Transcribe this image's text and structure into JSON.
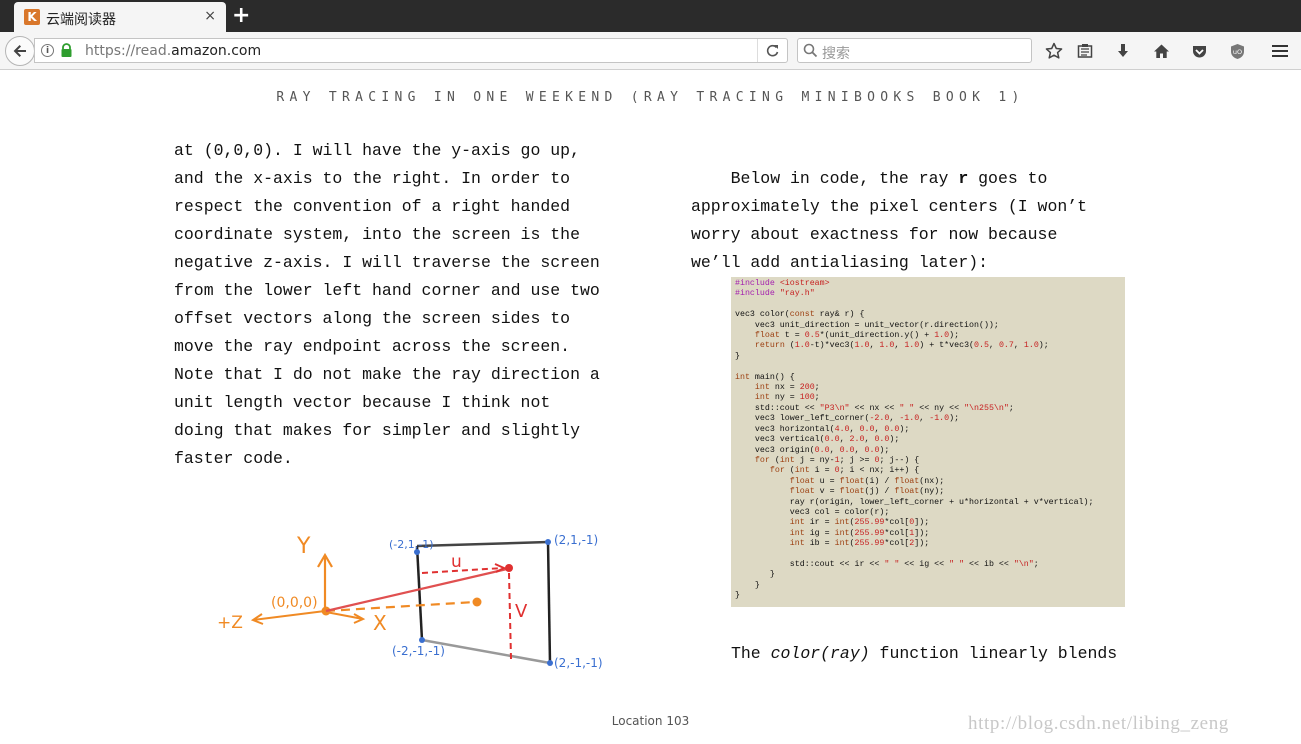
{
  "browser": {
    "tab": {
      "favicon_letter": "K",
      "title": "云端阅读器",
      "close": "×"
    },
    "new_tab": "+",
    "url": {
      "scheme": "https://read.",
      "host": "amazon.com"
    },
    "search_placeholder": "搜索"
  },
  "reader": {
    "header": "RAY TRACING IN ONE WEEKEND (RAY TRACING MINIBOOKS BOOK 1)",
    "left_lines": [
      "at (0,0,0). I will have the y-axis go up,",
      "and the x-axis to the right. In order to",
      "respect the convention of a right handed",
      "coordinate system, into the screen is the",
      "negative z-axis. I will traverse the screen",
      "from the lower left hand corner and use two",
      "offset vectors along the screen sides to",
      "move the ray endpoint across the screen.",
      "Note that I do not make the ray direction a",
      "unit length vector because I think not",
      "doing that makes for simpler and slightly",
      "faster code."
    ],
    "right_intro": {
      "line1_a": "    Below in code, the ray ",
      "line1_bold": "r",
      "line1_b": " goes to",
      "line2": "approximately the pixel centers (I won’t",
      "line3": "worry about exactness for now because",
      "line4": "we’ll add antialiasing later):"
    },
    "figure_labels": {
      "y_axis": "Y",
      "x_axis": "X",
      "z_axis": "+Z",
      "origin": "(0,0,0)",
      "top_left": "(-2,1,-1)",
      "top_right": "(2,1,-1)",
      "bottom_left": "(-2,-1,-1)",
      "bottom_right": "(2,-1,-1)",
      "u": "u",
      "v": "V"
    },
    "para2": {
      "before": "The ",
      "italic": "color(ray)",
      "after": " function linearly blends"
    },
    "location": "Location 103",
    "watermark": "http://blog.csdn.net/libing_zeng"
  },
  "code_lines": [
    [
      [
        "kw",
        "#include"
      ],
      [
        "t",
        " "
      ],
      [
        "str",
        "<iostream>"
      ]
    ],
    [
      [
        "kw",
        "#include"
      ],
      [
        "t",
        " "
      ],
      [
        "str",
        "\"ray.h\""
      ]
    ],
    [],
    [
      [
        "t",
        "vec3 color("
      ],
      [
        "ty",
        "const"
      ],
      [
        "t",
        " ray& r) {"
      ]
    ],
    [
      [
        "t",
        "    vec3 unit_direction = unit_vector(r.direction());"
      ]
    ],
    [
      [
        "t",
        "    "
      ],
      [
        "ty",
        "float"
      ],
      [
        "t",
        " t = "
      ],
      [
        "num",
        "0.5"
      ],
      [
        "t",
        "*(unit_direction.y() + "
      ],
      [
        "num",
        "1.0"
      ],
      [
        "t",
        ");"
      ]
    ],
    [
      [
        "t",
        "    "
      ],
      [
        "ty",
        "return"
      ],
      [
        "t",
        " ("
      ],
      [
        "num",
        "1.0"
      ],
      [
        "t",
        "-t)*vec3("
      ],
      [
        "num",
        "1.0"
      ],
      [
        "t",
        ", "
      ],
      [
        "num",
        "1.0"
      ],
      [
        "t",
        ", "
      ],
      [
        "num",
        "1.0"
      ],
      [
        "t",
        ") + t*vec3("
      ],
      [
        "num",
        "0.5"
      ],
      [
        "t",
        ", "
      ],
      [
        "num",
        "0.7"
      ],
      [
        "t",
        ", "
      ],
      [
        "num",
        "1.0"
      ],
      [
        "t",
        ");"
      ]
    ],
    [
      [
        "t",
        "}"
      ]
    ],
    [],
    [
      [
        "ty",
        "int"
      ],
      [
        "t",
        " main() {"
      ]
    ],
    [
      [
        "t",
        "    "
      ],
      [
        "ty",
        "int"
      ],
      [
        "t",
        " nx = "
      ],
      [
        "num",
        "200"
      ],
      [
        "t",
        ";"
      ]
    ],
    [
      [
        "t",
        "    "
      ],
      [
        "ty",
        "int"
      ],
      [
        "t",
        " ny = "
      ],
      [
        "num",
        "100"
      ],
      [
        "t",
        ";"
      ]
    ],
    [
      [
        "t",
        "    std::cout << "
      ],
      [
        "str",
        "\"P3\\n\""
      ],
      [
        "t",
        " << nx << "
      ],
      [
        "str",
        "\" \""
      ],
      [
        "t",
        " << ny << "
      ],
      [
        "str",
        "\"\\n255\\n\""
      ],
      [
        "t",
        ";"
      ]
    ],
    [
      [
        "t",
        "    vec3 lower_left_corner("
      ],
      [
        "num",
        "-2.0"
      ],
      [
        "t",
        ", "
      ],
      [
        "num",
        "-1.0"
      ],
      [
        "t",
        ", "
      ],
      [
        "num",
        "-1.0"
      ],
      [
        "t",
        ");"
      ]
    ],
    [
      [
        "t",
        "    vec3 horizontal("
      ],
      [
        "num",
        "4.0"
      ],
      [
        "t",
        ", "
      ],
      [
        "num",
        "0.0"
      ],
      [
        "t",
        ", "
      ],
      [
        "num",
        "0.0"
      ],
      [
        "t",
        ");"
      ]
    ],
    [
      [
        "t",
        "    vec3 vertical("
      ],
      [
        "num",
        "0.0"
      ],
      [
        "t",
        ", "
      ],
      [
        "num",
        "2.0"
      ],
      [
        "t",
        ", "
      ],
      [
        "num",
        "0.0"
      ],
      [
        "t",
        ");"
      ]
    ],
    [
      [
        "t",
        "    vec3 origin("
      ],
      [
        "num",
        "0.0"
      ],
      [
        "t",
        ", "
      ],
      [
        "num",
        "0.0"
      ],
      [
        "t",
        ", "
      ],
      [
        "num",
        "0.0"
      ],
      [
        "t",
        ");"
      ]
    ],
    [
      [
        "t",
        "    "
      ],
      [
        "ty",
        "for"
      ],
      [
        "t",
        " ("
      ],
      [
        "ty",
        "int"
      ],
      [
        "t",
        " j = ny-"
      ],
      [
        "num",
        "1"
      ],
      [
        "t",
        "; j >= "
      ],
      [
        "num",
        "0"
      ],
      [
        "t",
        "; j--) {"
      ]
    ],
    [
      [
        "t",
        "       "
      ],
      [
        "ty",
        "for"
      ],
      [
        "t",
        " ("
      ],
      [
        "ty",
        "int"
      ],
      [
        "t",
        " i = "
      ],
      [
        "num",
        "0"
      ],
      [
        "t",
        "; i < nx; i++) {"
      ]
    ],
    [
      [
        "t",
        "           "
      ],
      [
        "ty",
        "float"
      ],
      [
        "t",
        " u = "
      ],
      [
        "ty",
        "float"
      ],
      [
        "t",
        "(i) / "
      ],
      [
        "ty",
        "float"
      ],
      [
        "t",
        "(nx);"
      ]
    ],
    [
      [
        "t",
        "           "
      ],
      [
        "ty",
        "float"
      ],
      [
        "t",
        " v = "
      ],
      [
        "ty",
        "float"
      ],
      [
        "t",
        "(j) / "
      ],
      [
        "ty",
        "float"
      ],
      [
        "t",
        "(ny);"
      ]
    ],
    [
      [
        "t",
        "           ray r(origin, lower_left_corner + u*horizontal + v*vertical);"
      ]
    ],
    [
      [
        "t",
        "           vec3 col = color(r);"
      ]
    ],
    [
      [
        "t",
        "           "
      ],
      [
        "ty",
        "int"
      ],
      [
        "t",
        " ir = "
      ],
      [
        "ty",
        "int"
      ],
      [
        "t",
        "("
      ],
      [
        "num",
        "255.99"
      ],
      [
        "t",
        "*col["
      ],
      [
        "num",
        "0"
      ],
      [
        "t",
        "]);"
      ]
    ],
    [
      [
        "t",
        "           "
      ],
      [
        "ty",
        "int"
      ],
      [
        "t",
        " ig = "
      ],
      [
        "ty",
        "int"
      ],
      [
        "t",
        "("
      ],
      [
        "num",
        "255.99"
      ],
      [
        "t",
        "*col["
      ],
      [
        "num",
        "1"
      ],
      [
        "t",
        "]);"
      ]
    ],
    [
      [
        "t",
        "           "
      ],
      [
        "ty",
        "int"
      ],
      [
        "t",
        " ib = "
      ],
      [
        "ty",
        "int"
      ],
      [
        "t",
        "("
      ],
      [
        "num",
        "255.99"
      ],
      [
        "t",
        "*col["
      ],
      [
        "num",
        "2"
      ],
      [
        "t",
        "]);"
      ]
    ],
    [],
    [
      [
        "t",
        "           std::cout << ir << "
      ],
      [
        "str",
        "\" \""
      ],
      [
        "t",
        " << ig << "
      ],
      [
        "str",
        "\" \""
      ],
      [
        "t",
        " << ib << "
      ],
      [
        "str",
        "\"\\n\""
      ],
      [
        "t",
        ";"
      ]
    ],
    [
      [
        "t",
        "       }"
      ]
    ],
    [
      [
        "t",
        "    }"
      ]
    ],
    [
      [
        "t",
        "}"
      ]
    ]
  ]
}
